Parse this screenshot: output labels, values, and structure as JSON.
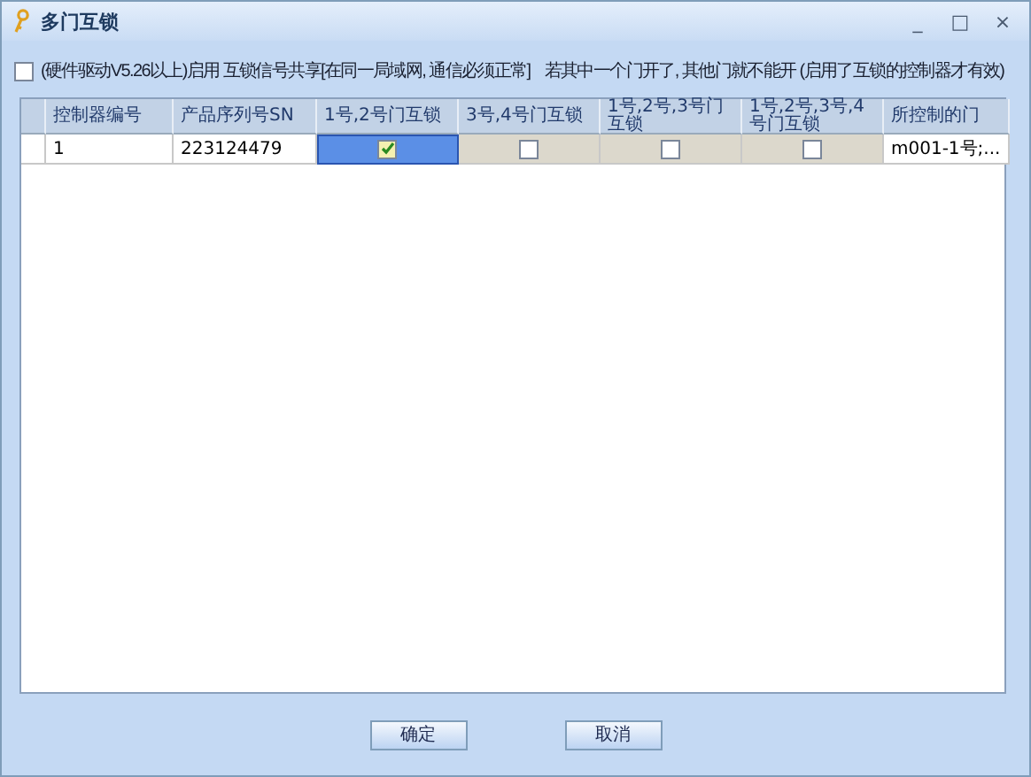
{
  "window": {
    "title": "多门互锁",
    "controls": [
      "_",
      "□",
      "×"
    ]
  },
  "share_option": {
    "checked": false,
    "label": "(硬件驱动V5.26以上)启用 互锁信号共享[在同一局域网, 通信必须正常]",
    "note": "若其中一个门开了, 其他门就不能开 (启用了互锁的控制器才有效)"
  },
  "table": {
    "columns": [
      "控制器编号",
      "产品序列号SN",
      "1号,2号门互锁",
      "3号,4号门互锁",
      "1号,2号,3号门互锁",
      "1号,2号,3号,4号门互锁",
      "所控制的门"
    ],
    "rows": [
      {
        "cells": [
          {
            "kind": "text",
            "text": "1",
            "selected": false
          },
          {
            "kind": "text",
            "text": "223124479",
            "selected": false
          },
          {
            "kind": "check",
            "checked": true,
            "selected": true
          },
          {
            "kind": "check",
            "checked": false,
            "selected": false
          },
          {
            "kind": "check",
            "checked": false,
            "selected": false
          },
          {
            "kind": "check",
            "checked": false,
            "selected": false
          },
          {
            "kind": "doors",
            "text": "m001-1号;",
            "more": "...",
            "selected": false
          }
        ]
      }
    ]
  },
  "buttons": [
    "确定",
    "取消"
  ]
}
